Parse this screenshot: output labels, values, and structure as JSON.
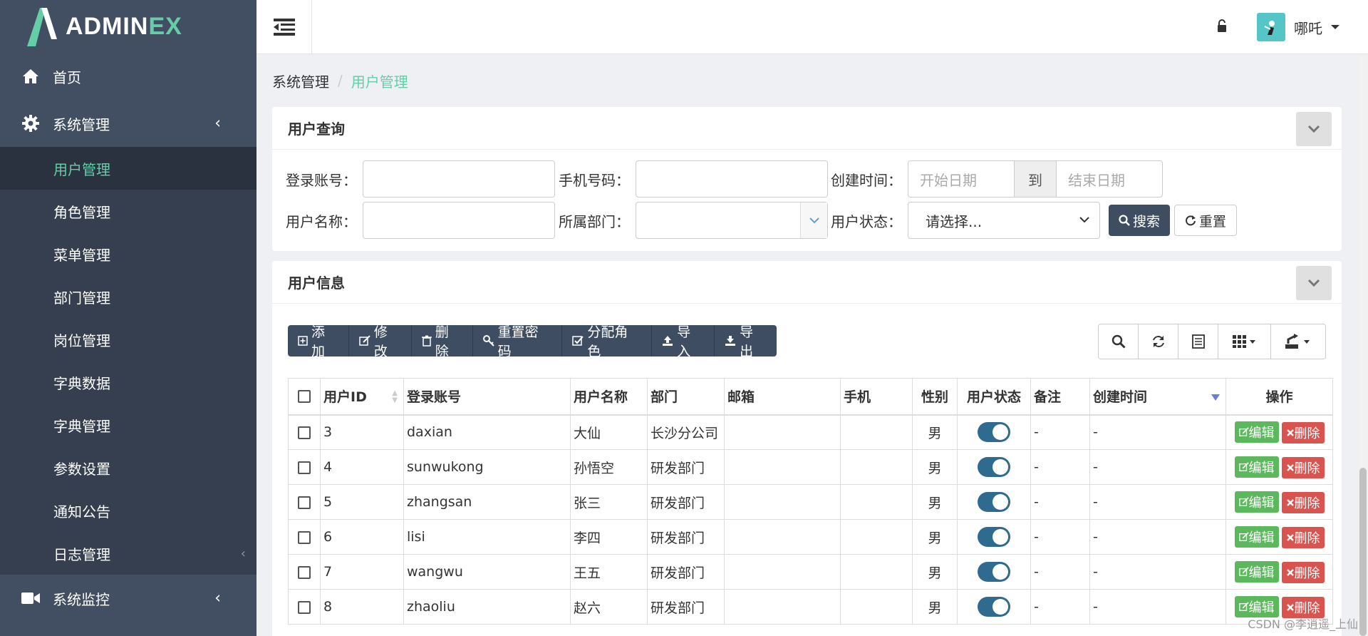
{
  "brand": {
    "name_main": "ADMIN",
    "name_accent": "EX"
  },
  "sidebar": {
    "home": "首页",
    "system": "系统管理",
    "sub_items": [
      {
        "label": "用户管理",
        "active": true
      },
      {
        "label": "角色管理"
      },
      {
        "label": "菜单管理"
      },
      {
        "label": "部门管理"
      },
      {
        "label": "岗位管理"
      },
      {
        "label": "字典数据"
      },
      {
        "label": "字典管理"
      },
      {
        "label": "参数设置"
      },
      {
        "label": "通知公告"
      },
      {
        "label": "日志管理"
      }
    ],
    "monitor": "系统监控"
  },
  "header": {
    "username": "哪吒"
  },
  "breadcrumb": {
    "parent": "系统管理",
    "separator": "/",
    "current": "用户管理"
  },
  "query": {
    "title": "用户查询",
    "login_label": "登录账号：",
    "phone_label": "手机号码：",
    "created_label": "创建时间：",
    "start_placeholder": "开始日期",
    "to": "到",
    "end_placeholder": "结束日期",
    "username_label": "用户名称：",
    "dept_label": "所属部门：",
    "status_label": "用户状态：",
    "status_value": "请选择...",
    "search_btn": "搜索",
    "reset_btn": "重置"
  },
  "info": {
    "title": "用户信息",
    "toolbar": {
      "add": "添加",
      "edit": "修改",
      "delete": "删除",
      "reset_pwd": "重置密码",
      "assign_role": "分配角色",
      "import": "导入",
      "export": "导出"
    }
  },
  "table": {
    "headers": {
      "id": "用户ID",
      "account": "登录账号",
      "name": "用户名称",
      "dept": "部门",
      "email": "邮箱",
      "phone": "手机",
      "gender": "性别",
      "status": "用户状态",
      "remark": "备注",
      "created": "创建时间",
      "actions": "操作"
    },
    "edit_label": "编辑",
    "delete_label": "删除",
    "rows": [
      {
        "id": "3",
        "account": "daxian",
        "name": "大仙",
        "dept": "长沙分公司",
        "email": "",
        "phone": "",
        "gender": "男",
        "remark": "-",
        "created": "-"
      },
      {
        "id": "4",
        "account": "sunwukong",
        "name": "孙悟空",
        "dept": "研发部门",
        "email": "",
        "phone": "",
        "gender": "男",
        "remark": "-",
        "created": "-"
      },
      {
        "id": "5",
        "account": "zhangsan",
        "name": "张三",
        "dept": "研发部门",
        "email": "",
        "phone": "",
        "gender": "男",
        "remark": "-",
        "created": "-"
      },
      {
        "id": "6",
        "account": "lisi",
        "name": "李四",
        "dept": "研发部门",
        "email": "",
        "phone": "",
        "gender": "男",
        "remark": "-",
        "created": "-"
      },
      {
        "id": "7",
        "account": "wangwu",
        "name": "王五",
        "dept": "研发部门",
        "email": "",
        "phone": "",
        "gender": "男",
        "remark": "-",
        "created": "-"
      },
      {
        "id": "8",
        "account": "zhaoliu",
        "name": "赵六",
        "dept": "研发部门",
        "email": "",
        "phone": "",
        "gender": "男",
        "remark": "-",
        "created": "-"
      }
    ]
  },
  "watermark": "CSDN @李逍遥_上仙",
  "colors": {
    "sidebar": "#424f63",
    "accent": "#65cea7",
    "primary": "#3f4d63",
    "success": "#5cb85c",
    "danger": "#d9534f"
  }
}
